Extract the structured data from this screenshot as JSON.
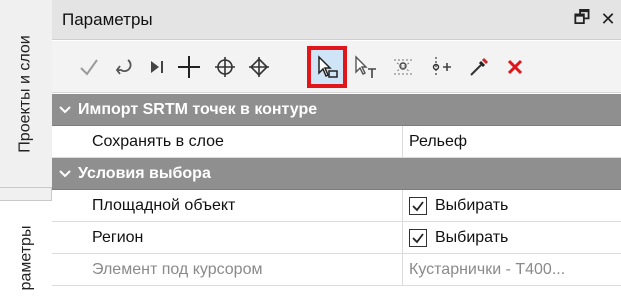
{
  "side_tabs": [
    "Проекты и слои",
    "раметры"
  ],
  "panel": {
    "title": "Параметры",
    "title_buttons": {
      "float": "🗗",
      "close": "✕"
    }
  },
  "toolbar": {
    "buttons": [
      "check-icon",
      "undo-icon",
      "step-end-icon",
      "crosshair-plus-icon",
      "circle-cross-icon",
      "diamond-cross-icon",
      "cursor-select-icon",
      "cursor-text-icon",
      "snap-point-icon",
      "vertex-add-icon",
      "eyedropper-icon",
      "delete-icon"
    ],
    "active_index": 6,
    "accent_color": "#e0161b"
  },
  "sections": [
    {
      "title": "Импорт SRTM точек в контуре",
      "rows": [
        {
          "label": "Сохранять в слое",
          "value": "Рельеф",
          "checkbox": false,
          "dim": false
        }
      ]
    },
    {
      "title": "Условия выбора",
      "rows": [
        {
          "label": "Площадной объект",
          "value": "Выбирать",
          "checkbox": true,
          "dim": false
        },
        {
          "label": "Регион",
          "value": "Выбирать",
          "checkbox": true,
          "dim": false
        },
        {
          "label": "Элемент под курсором",
          "value": "Кустарнички - Т400...",
          "checkbox": false,
          "dim": true
        }
      ]
    }
  ]
}
